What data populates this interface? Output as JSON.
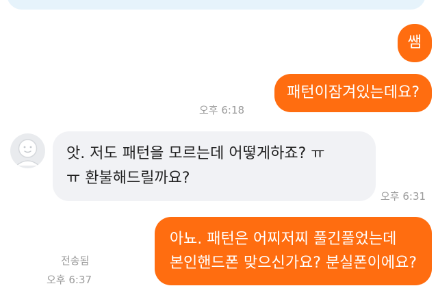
{
  "messages": [
    {
      "side": "outgoing",
      "text": "쌤"
    },
    {
      "side": "outgoing",
      "text": "패턴이잠겨있는데요?",
      "time": "오후 6:18"
    },
    {
      "side": "incoming",
      "line1": "앗. 저도 패턴을 모르는데 어떻게하죠? ㅠ",
      "line2": "ㅠ 환불해드릴까요?",
      "time": "오후 6:31"
    },
    {
      "side": "outgoing",
      "line1": "아뇨. 패턴은 어찌저찌 풀긴풀었는데",
      "line2": "본인핸드폰 맞으신가요? 분실폰이에요?",
      "status": "전송됨",
      "time": "오후 6:37"
    }
  ],
  "colors": {
    "outgoing_bubble": "#ff6d10",
    "incoming_bubble": "#f1f2f5",
    "time_text": "#9a9a9a",
    "top_bubble": "#e6f3fb"
  },
  "icons": {
    "avatar": "default-profile-icon"
  }
}
